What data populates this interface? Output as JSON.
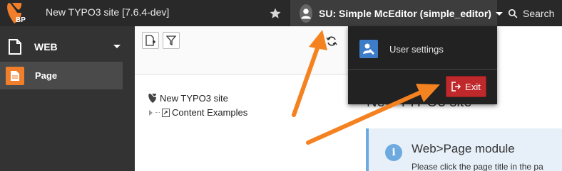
{
  "header": {
    "logo_text": "BP",
    "site_title": "New TYPO3 site [7.6.4-dev]",
    "user_label": "SU: Simple McEditor (simple_editor)",
    "search_label": "Search"
  },
  "sidebar": {
    "group_label": "WEB",
    "items": [
      {
        "label": "Page"
      }
    ]
  },
  "tree": {
    "root_label": "New TYPO3 site",
    "child_label": "Content Examples"
  },
  "user_menu": {
    "settings_label": "User settings",
    "exit_label": "Exit"
  },
  "content": {
    "title_partial": "New TYPO3 site",
    "info_title": "Web>Page module",
    "info_text": "Please click the page title in the pa"
  },
  "colors": {
    "accent_orange": "#f07e2b",
    "exit_red": "#c0292b",
    "info_blue": "#6daae0",
    "arrow_orange": "#f58220"
  },
  "icons": [
    "typo3-logo",
    "star-icon",
    "user-icon",
    "search-icon",
    "document-icon",
    "page-icon",
    "new-page-icon",
    "filter-icon",
    "refresh-icon",
    "typo3-icon",
    "user-settings-icon",
    "logout-icon",
    "info-icon"
  ]
}
